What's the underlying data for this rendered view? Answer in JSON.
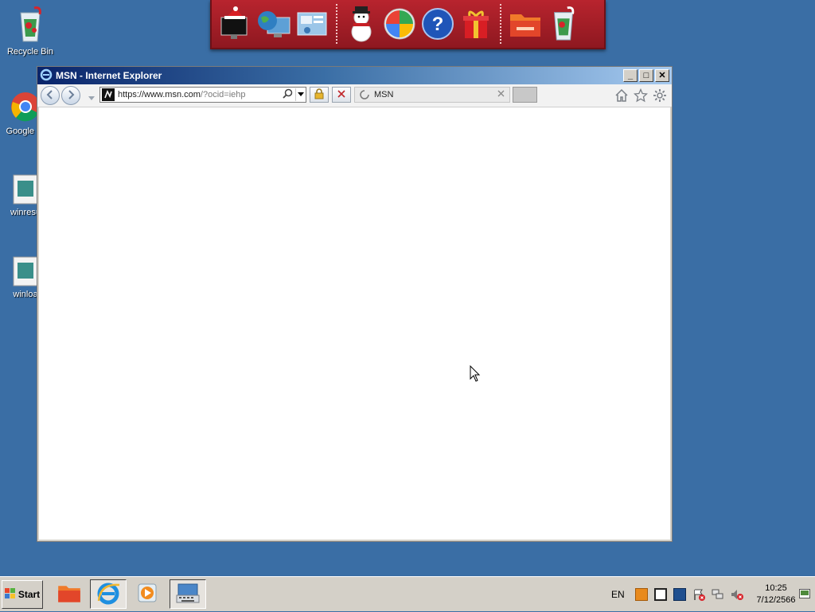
{
  "desktop": {
    "icons": [
      {
        "label": "Recycle Bin",
        "icon": "recycle-bin-icon"
      },
      {
        "label": "Google Cl",
        "icon": "chrome-icon"
      },
      {
        "label": "winresu",
        "icon": "document-icon"
      },
      {
        "label": "winloa",
        "icon": "document-icon"
      }
    ]
  },
  "dock": {
    "items": [
      "santa-monitor-icon",
      "globe-monitor-icon",
      "control-panel-icon",
      "snowman-icon",
      "windows-logo-icon",
      "help-icon",
      "gift-icon",
      "folder-icon",
      "recycle-bin-icon"
    ]
  },
  "window": {
    "title": "MSN - Internet Explorer",
    "buttons": {
      "minimize": "_",
      "maximize": "□",
      "close": "✕"
    },
    "address": {
      "prefix": "https://www.",
      "domain": "msn.com",
      "path": "/?ocid=iehp"
    },
    "tab": {
      "label": "MSN"
    }
  },
  "taskbar": {
    "start_label": "Start",
    "language": "EN",
    "time": "10:25",
    "date": "7/12/2566"
  },
  "colors": {
    "desktop": "#3a6ea5",
    "dock": "#b8242e",
    "titlebar": "#0a246a"
  }
}
